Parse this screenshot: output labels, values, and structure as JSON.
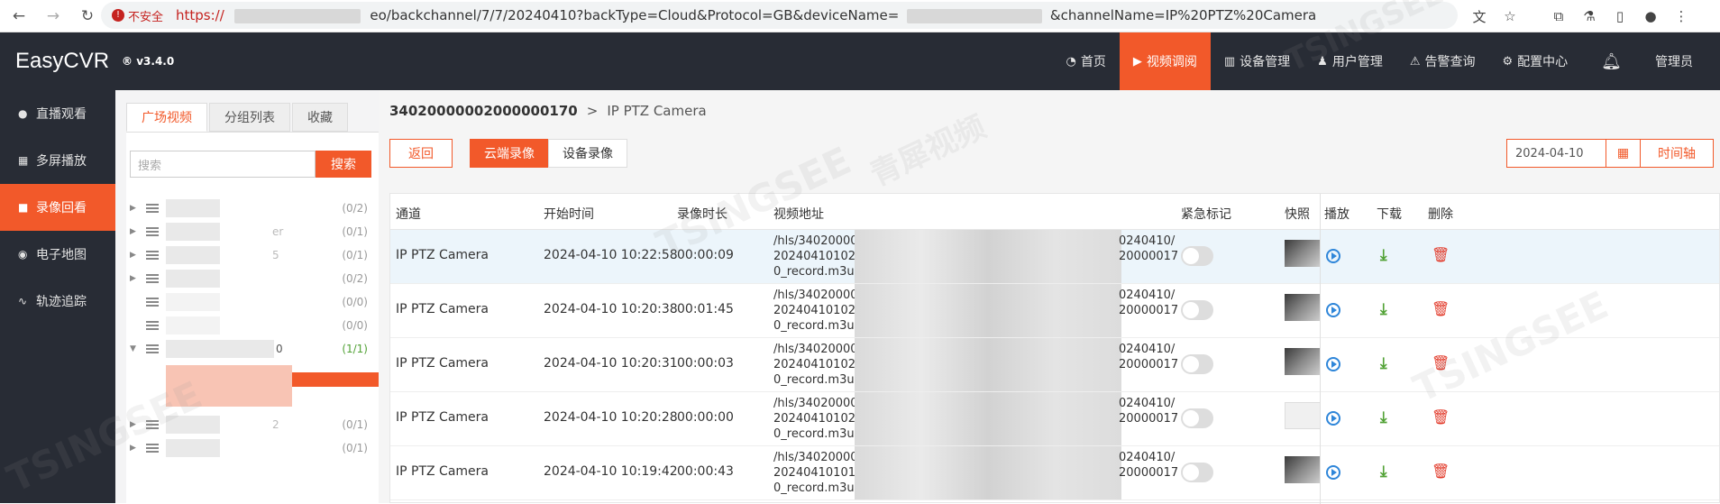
{
  "browser": {
    "security_label": "不安全",
    "url_scheme": "https://",
    "url_path_1": "eo/backchannel/7/7/20240410?backType=Cloud&Protocol=GB&deviceName=",
    "url_path_2": "&channelName=IP%20PTZ%20Camera"
  },
  "app": {
    "name": "EasyCVR",
    "version": "v3.4.0"
  },
  "topnav": {
    "items": [
      "首页",
      "视频调阅",
      "设备管理",
      "用户管理",
      "告警查询",
      "配置中心"
    ],
    "user": "管理员"
  },
  "sidebar": {
    "items": [
      "直播观看",
      "多屏播放",
      "录像回看",
      "电子地图",
      "轨迹追踪"
    ]
  },
  "tree": {
    "tabs": [
      "广场视频",
      "分组列表",
      "收藏"
    ],
    "search_placeholder": "搜索",
    "search_button": "搜索",
    "nodes": [
      {
        "count": "(0/2)",
        "suffix": ""
      },
      {
        "count": "(0/1)",
        "suffix": "er"
      },
      {
        "count": "(0/1)",
        "suffix": "5"
      },
      {
        "count": "(0/2)",
        "suffix": ""
      },
      {
        "count": "(0/0)",
        "suffix": ""
      },
      {
        "count": "(0/0)",
        "suffix": ""
      },
      {
        "count": "(1/1)",
        "suffix": "0"
      },
      {
        "count": "(0/1)",
        "suffix": "2"
      },
      {
        "count": "(0/1)",
        "suffix": ""
      }
    ]
  },
  "main": {
    "breadcrumb_id": "34020000002000000170",
    "breadcrumb_sep": ">",
    "breadcrumb_name": "IP PTZ Camera",
    "back_button": "返回",
    "cloud_tab": "云端录像",
    "device_tab": "设备录像",
    "date": "2024-04-10",
    "timeline_button": "时间轴"
  },
  "table": {
    "headers": [
      "通道",
      "开始时间",
      "录像时长",
      "视频地址",
      "紧急标记",
      "快照",
      "播放",
      "下载",
      "删除"
    ],
    "rows": [
      {
        "channel": "IP PTZ Camera",
        "start": "2024-04-10 10:22:58",
        "duration": "00:00:09",
        "addr_l1": "/hls/3402000000",
        "addr_l2": "2024041010225",
        "addr_l3": "0_record.m3u8",
        "addr_r1": "0240410/",
        "addr_r2": "20000017"
      },
      {
        "channel": "IP PTZ Camera",
        "start": "2024-04-10 10:20:38",
        "duration": "00:01:45",
        "addr_l1": "/hls/3402000000",
        "addr_l2": "2024041010203",
        "addr_l3": "0_record.m3u8",
        "addr_r1": "0240410/",
        "addr_r2": "20000017"
      },
      {
        "channel": "IP PTZ Camera",
        "start": "2024-04-10 10:20:31",
        "duration": "00:00:03",
        "addr_l1": "/hls/3402000000",
        "addr_l2": "2024041010203",
        "addr_l3": "0_record.m3u8",
        "addr_r1": "0240410/",
        "addr_r2": "20000017"
      },
      {
        "channel": "IP PTZ Camera",
        "start": "2024-04-10 10:20:28",
        "duration": "00:00:00",
        "addr_l1": "/hls/3402000000",
        "addr_l2": "2024041010202",
        "addr_l3": "0_record.m3u8",
        "addr_r1": "0240410/",
        "addr_r2": "20000017"
      },
      {
        "channel": "IP PTZ Camera",
        "start": "2024-04-10 10:19:42",
        "duration": "00:00:43",
        "addr_l1": "/hls/3402000000",
        "addr_l2": "2024041010194",
        "addr_l3": "0_record.m3u8",
        "addr_r1": "0240410/",
        "addr_r2": "20000017"
      }
    ]
  },
  "watermark": {
    "brand": "TSINGSEE",
    "cn": "青犀视频"
  },
  "colors": {
    "accent": "#f2592a",
    "nav_bg": "#282c35",
    "play": "#2f86d9",
    "download": "#52a236",
    "delete": "#e23a2a"
  }
}
